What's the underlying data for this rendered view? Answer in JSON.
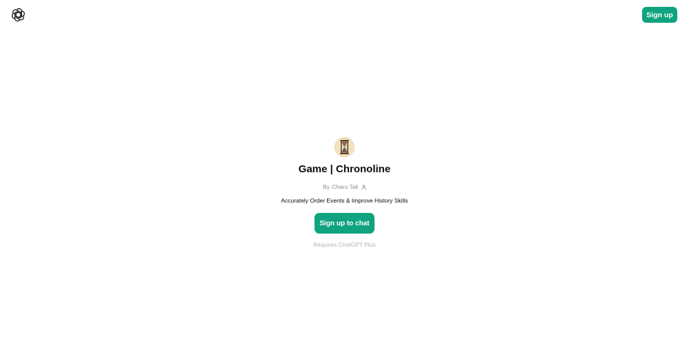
{
  "header": {
    "logo_icon": "openai-logo-icon",
    "signup_label": "Sign up"
  },
  "gpt": {
    "avatar_icon": "hourglass-avatar-icon",
    "title": "Game | Chronoline",
    "by_prefix": "By",
    "author": "Charu Tak",
    "author_icon": "person-icon",
    "description": "Accurately Order Events & Improve History Skills",
    "chat_button_label": "Sign up to chat",
    "requirement": "Requires ChatGPT Plus"
  },
  "colors": {
    "accent": "#10a37f",
    "muted_text": "#8e8e8e",
    "faint_text": "#b4b4b4"
  }
}
